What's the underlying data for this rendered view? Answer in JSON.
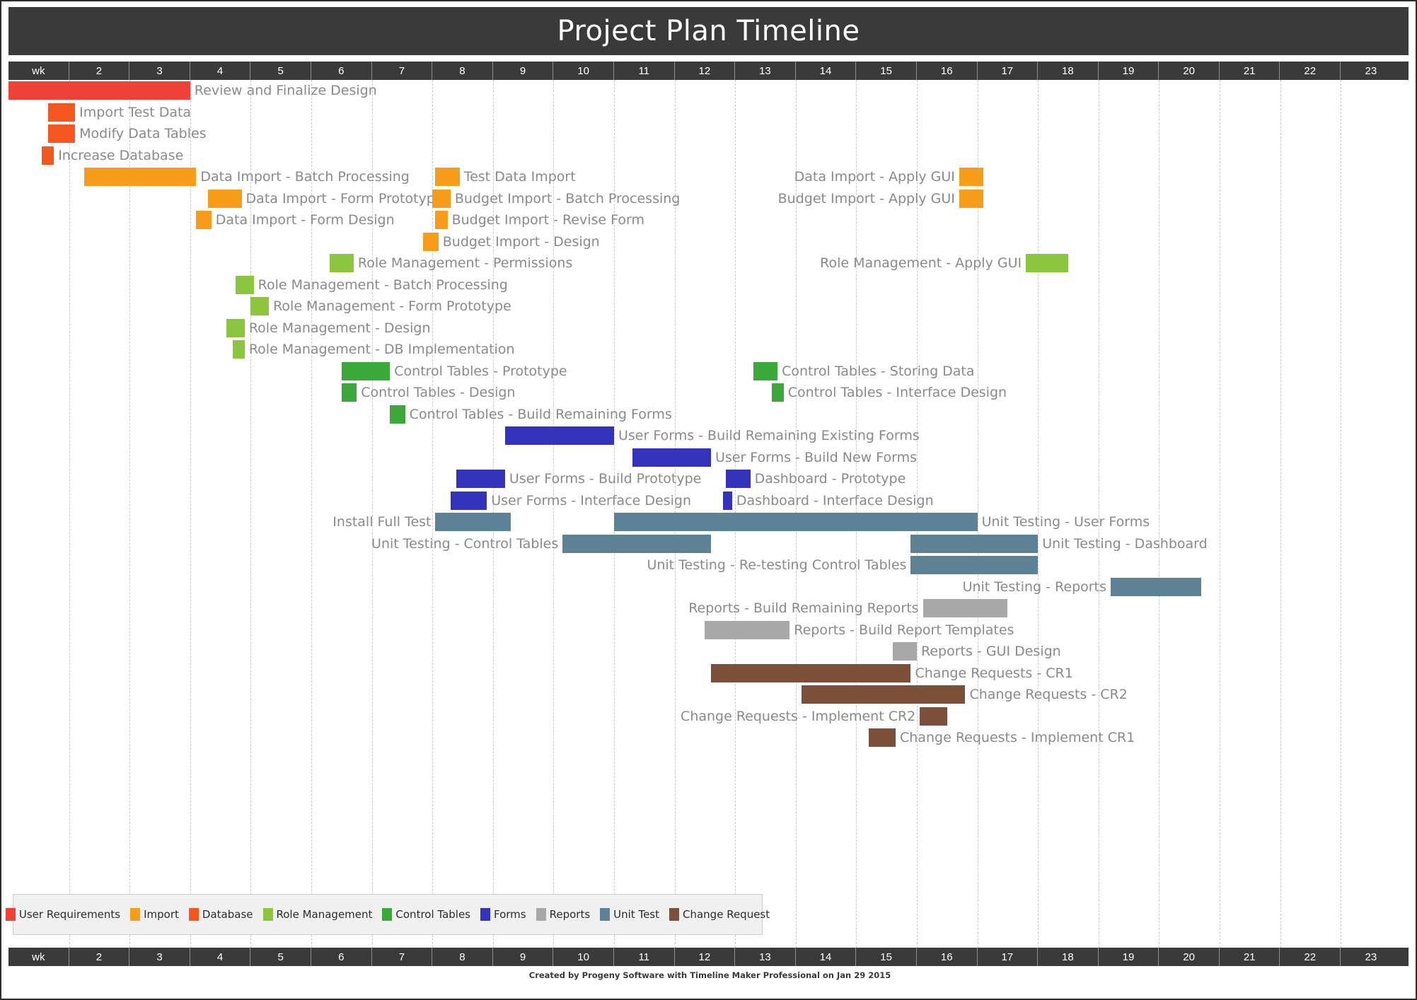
{
  "header": {
    "title": "Project Plan Timeline"
  },
  "axis": {
    "week_labels": [
      "wk",
      "2",
      "3",
      "4",
      "5",
      "6",
      "7",
      "8",
      "9",
      "10",
      "11",
      "12",
      "13",
      "14",
      "15",
      "16",
      "17",
      "18",
      "19",
      "20",
      "21",
      "22",
      "23"
    ]
  },
  "footer": {
    "credit": "Created by Progeny Software with Timeline Maker Professional on Jan 29 2015"
  },
  "legend": {
    "items": [
      {
        "label": "User Requirements",
        "color": "#ef4136"
      },
      {
        "label": "Import",
        "color": "#f89c1c"
      },
      {
        "label": "Database",
        "color": "#f4571f"
      },
      {
        "label": "Role Management",
        "color": "#8cc63e"
      },
      {
        "label": "Control Tables",
        "color": "#3aa93a"
      },
      {
        "label": "Forms",
        "color": "#3333bb"
      },
      {
        "label": "Reports",
        "color": "#a8a8a8"
      },
      {
        "label": "Unit Test",
        "color": "#5e8295"
      },
      {
        "label": "Change Request",
        "color": "#7c4f3a"
      }
    ]
  },
  "chart_data": {
    "type": "bar",
    "title": "Project Plan Timeline",
    "xlabel": "wk",
    "ylabel": "",
    "xlim": [
      1,
      24
    ],
    "grid": true,
    "legend_position": "bottom-left",
    "categories": [
      "Review and Finalize Design",
      "Import Test Data",
      "Modify Data Tables",
      "Increase Database",
      "Data Import - Batch Processing",
      "Test Data Import",
      "Data Import - Apply GUI",
      "Data Import - Form Prototype",
      "Budget Import  - Batch Processing",
      "Budget Import - Apply GUI",
      "Data Import - Form Design",
      "Budget Import - Revise Form",
      "Budget Import - Design",
      "Role Management - Permissions",
      "Role Management - Apply GUI",
      "Role Management - Batch Processing",
      "Role Management - Form Prototype",
      "Role Management - Design",
      "Role Management - DB Implementation",
      "Control Tables - Prototype",
      "Control Tables - Storing Data",
      "Control Tables - Design",
      "Control Tables - Interface Design",
      "Control Tables - Build Remaining Forms",
      "User Forms - Build Remaining Existing Forms",
      "User Forms - Build New Forms",
      "User Forms - Build Prototype",
      "Dashboard - Prototype",
      "User Forms - Interface Design",
      "Dashboard - Interface Design",
      "Install Full Test",
      "Unit Testing - User Forms",
      "Unit Testing - Control Tables",
      "Unit Testing - Dashboard",
      "Unit Testing - Re-testing Control Tables",
      "Unit Testing - Reports",
      "Reports - Build Remaining Reports",
      "Reports - Build Report Templates",
      "Reports - GUI Design",
      "Change Requests - CR1",
      "Change Requests - CR2",
      "Change Requests - Implement CR2",
      "Change Requests - Implement CR1"
    ],
    "tasks": [
      {
        "row": 0,
        "label": "Review and Finalize Design",
        "start": 1.0,
        "end": 4.0,
        "category": "User Requirements",
        "color": "#ef4136",
        "label_side": "right"
      },
      {
        "row": 1,
        "label": "Import Test Data",
        "start": 1.65,
        "end": 2.1,
        "category": "Import",
        "color": "#f4571f",
        "label_side": "right"
      },
      {
        "row": 2,
        "label": "Modify Data Tables",
        "start": 1.65,
        "end": 2.1,
        "category": "Database",
        "color": "#f4571f",
        "label_side": "right"
      },
      {
        "row": 3,
        "label": "Increase Database",
        "start": 1.55,
        "end": 1.75,
        "category": "Database",
        "color": "#f4571f",
        "label_side": "right"
      },
      {
        "row": 4,
        "label": "Data Import - Batch Processing",
        "start": 2.25,
        "end": 4.1,
        "category": "Import",
        "color": "#f89c1c",
        "label_side": "right"
      },
      {
        "row": 4,
        "label": "Test Data Import",
        "start": 8.05,
        "end": 8.45,
        "category": "Import",
        "color": "#f89c1c",
        "label_side": "right"
      },
      {
        "row": 4,
        "label": "Data Import - Apply GUI",
        "start": 16.7,
        "end": 17.1,
        "category": "Import",
        "color": "#f89c1c",
        "label_side": "left"
      },
      {
        "row": 5,
        "label": "Data Import - Form Prototype",
        "start": 4.3,
        "end": 4.85,
        "category": "Import",
        "color": "#f89c1c",
        "label_side": "right"
      },
      {
        "row": 5,
        "label": "Budget Import  - Batch Processing",
        "start": 8.0,
        "end": 8.3,
        "category": "Import",
        "color": "#f89c1c",
        "label_side": "right"
      },
      {
        "row": 5,
        "label": "Budget Import - Apply GUI",
        "start": 16.7,
        "end": 17.1,
        "category": "Import",
        "color": "#f89c1c",
        "label_side": "left"
      },
      {
        "row": 6,
        "label": "Data Import - Form Design",
        "start": 4.1,
        "end": 4.35,
        "category": "Import",
        "color": "#f89c1c",
        "label_side": "right"
      },
      {
        "row": 6,
        "label": "Budget Import - Revise Form",
        "start": 8.05,
        "end": 8.25,
        "category": "Import",
        "color": "#f89c1c",
        "label_side": "right"
      },
      {
        "row": 7,
        "label": "Budget Import - Design",
        "start": 7.85,
        "end": 8.1,
        "category": "Import",
        "color": "#f89c1c",
        "label_side": "right"
      },
      {
        "row": 8,
        "label": "Role Management - Permissions",
        "start": 6.3,
        "end": 6.7,
        "category": "Role Management",
        "color": "#8cc63e",
        "label_side": "right"
      },
      {
        "row": 8,
        "label": "Role Management - Apply GUI",
        "start": 17.8,
        "end": 18.5,
        "category": "Role Management",
        "color": "#8cc63e",
        "label_side": "left"
      },
      {
        "row": 9,
        "label": "Role Management - Batch Processing",
        "start": 4.75,
        "end": 5.05,
        "category": "Role Management",
        "color": "#8cc63e",
        "label_side": "right"
      },
      {
        "row": 10,
        "label": "Role Management - Form Prototype",
        "start": 5.0,
        "end": 5.3,
        "category": "Role Management",
        "color": "#8cc63e",
        "label_side": "right"
      },
      {
        "row": 11,
        "label": "Role Management - Design",
        "start": 4.6,
        "end": 4.9,
        "category": "Role Management",
        "color": "#8cc63e",
        "label_side": "right"
      },
      {
        "row": 12,
        "label": "Role Management - DB Implementation",
        "start": 4.7,
        "end": 4.9,
        "category": "Role Management",
        "color": "#8cc63e",
        "label_side": "right"
      },
      {
        "row": 13,
        "label": "Control Tables - Prototype",
        "start": 6.5,
        "end": 7.3,
        "category": "Control Tables",
        "color": "#3aa93a",
        "label_side": "right"
      },
      {
        "row": 13,
        "label": "Control Tables - Storing Data",
        "start": 13.3,
        "end": 13.7,
        "category": "Control Tables",
        "color": "#3aa93a",
        "label_side": "right"
      },
      {
        "row": 14,
        "label": "Control Tables - Design",
        "start": 6.5,
        "end": 6.75,
        "category": "Control Tables",
        "color": "#3aa93a",
        "label_side": "right"
      },
      {
        "row": 14,
        "label": "Control Tables - Interface Design",
        "start": 13.6,
        "end": 13.8,
        "category": "Control Tables",
        "color": "#3aa93a",
        "label_side": "right"
      },
      {
        "row": 15,
        "label": "Control Tables - Build Remaining Forms",
        "start": 7.3,
        "end": 7.55,
        "category": "Control Tables",
        "color": "#3aa93a",
        "label_side": "right"
      },
      {
        "row": 16,
        "label": "User Forms - Build Remaining Existing Forms",
        "start": 9.2,
        "end": 11.0,
        "category": "Forms",
        "color": "#3333bb",
        "label_side": "right"
      },
      {
        "row": 17,
        "label": "User Forms - Build New Forms",
        "start": 11.3,
        "end": 12.6,
        "category": "Forms",
        "color": "#3333bb",
        "label_side": "right"
      },
      {
        "row": 18,
        "label": "User Forms - Build Prototype",
        "start": 8.4,
        "end": 9.2,
        "category": "Forms",
        "color": "#3333bb",
        "label_side": "right"
      },
      {
        "row": 18,
        "label": "Dashboard - Prototype",
        "start": 12.85,
        "end": 13.25,
        "category": "Forms",
        "color": "#3333bb",
        "label_side": "right"
      },
      {
        "row": 19,
        "label": "User Forms - Interface Design",
        "start": 8.3,
        "end": 8.9,
        "category": "Forms",
        "color": "#3333bb",
        "label_side": "right"
      },
      {
        "row": 19,
        "label": "Dashboard - Interface Design",
        "start": 12.8,
        "end": 12.95,
        "category": "Forms",
        "color": "#3333bb",
        "label_side": "right"
      },
      {
        "row": 20,
        "label": "Install Full Test",
        "start": 8.05,
        "end": 9.3,
        "category": "Unit Test",
        "color": "#5e8295",
        "label_side": "left"
      },
      {
        "row": 20,
        "label": "Unit Testing - User Forms",
        "start": 11.0,
        "end": 17.0,
        "category": "Unit Test",
        "color": "#5e8295",
        "label_side": "right"
      },
      {
        "row": 21,
        "label": "Unit Testing - Control Tables",
        "start": 10.15,
        "end": 12.6,
        "category": "Unit Test",
        "color": "#5e8295",
        "label_side": "left"
      },
      {
        "row": 21,
        "label": "Unit Testing - Dashboard",
        "start": 15.9,
        "end": 18.0,
        "category": "Unit Test",
        "color": "#5e8295",
        "label_side": "right"
      },
      {
        "row": 22,
        "label": "Unit Testing - Re-testing Control Tables",
        "start": 15.9,
        "end": 18.0,
        "category": "Unit Test",
        "color": "#5e8295",
        "label_side": "left"
      },
      {
        "row": 23,
        "label": "Unit Testing - Reports",
        "start": 19.2,
        "end": 20.7,
        "category": "Unit Test",
        "color": "#5e8295",
        "label_side": "left"
      },
      {
        "row": 24,
        "label": "Reports - Build Remaining Reports",
        "start": 16.1,
        "end": 17.5,
        "category": "Reports",
        "color": "#a8a8a8",
        "label_side": "left"
      },
      {
        "row": 25,
        "label": "Reports - Build Report Templates",
        "start": 12.5,
        "end": 13.9,
        "category": "Reports",
        "color": "#a8a8a8",
        "label_side": "right"
      },
      {
        "row": 26,
        "label": "Reports - GUI Design",
        "start": 15.6,
        "end": 16.0,
        "category": "Reports",
        "color": "#a8a8a8",
        "label_side": "right"
      },
      {
        "row": 27,
        "label": "Change Requests - CR1",
        "start": 12.6,
        "end": 15.9,
        "category": "Change Request",
        "color": "#7c4f3a",
        "label_side": "right"
      },
      {
        "row": 28,
        "label": "Change Requests - CR2",
        "start": 14.1,
        "end": 16.8,
        "category": "Change Request",
        "color": "#7c4f3a",
        "label_side": "right"
      },
      {
        "row": 29,
        "label": "Change Requests - Implement CR2",
        "start": 16.05,
        "end": 16.5,
        "category": "Change Request",
        "color": "#7c4f3a",
        "label_side": "left"
      },
      {
        "row": 30,
        "label": "Change Requests - Implement CR1",
        "start": 15.2,
        "end": 15.65,
        "category": "Change Request",
        "color": "#7c4f3a",
        "label_side": "right"
      }
    ]
  }
}
